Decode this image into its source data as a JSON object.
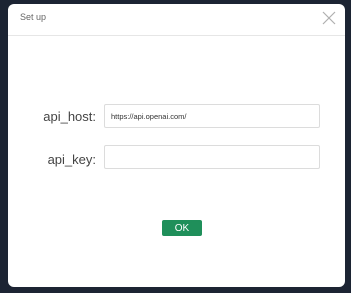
{
  "dialog": {
    "title": "Set up",
    "close_icon": "close-icon"
  },
  "form": {
    "api_host_label": "api_host:",
    "api_host_value": "https://api.openai.com/",
    "api_key_label": "api_key:",
    "api_key_value": "",
    "ok_label": "OK"
  },
  "colors": {
    "background": "#1c2433",
    "ok_button": "#1f8f5a"
  }
}
